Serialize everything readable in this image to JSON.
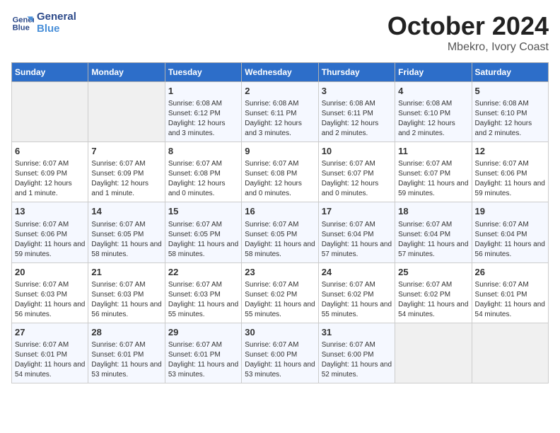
{
  "logo": {
    "line1": "General",
    "line2": "Blue"
  },
  "title": "October 2024",
  "subtitle": "Mbekro, Ivory Coast",
  "days_of_week": [
    "Sunday",
    "Monday",
    "Tuesday",
    "Wednesday",
    "Thursday",
    "Friday",
    "Saturday"
  ],
  "weeks": [
    [
      {
        "day": "",
        "info": ""
      },
      {
        "day": "",
        "info": ""
      },
      {
        "day": "1",
        "info": "Sunrise: 6:08 AM\nSunset: 6:12 PM\nDaylight: 12 hours and 3 minutes."
      },
      {
        "day": "2",
        "info": "Sunrise: 6:08 AM\nSunset: 6:11 PM\nDaylight: 12 hours and 3 minutes."
      },
      {
        "day": "3",
        "info": "Sunrise: 6:08 AM\nSunset: 6:11 PM\nDaylight: 12 hours and 2 minutes."
      },
      {
        "day": "4",
        "info": "Sunrise: 6:08 AM\nSunset: 6:10 PM\nDaylight: 12 hours and 2 minutes."
      },
      {
        "day": "5",
        "info": "Sunrise: 6:08 AM\nSunset: 6:10 PM\nDaylight: 12 hours and 2 minutes."
      }
    ],
    [
      {
        "day": "6",
        "info": "Sunrise: 6:07 AM\nSunset: 6:09 PM\nDaylight: 12 hours and 1 minute."
      },
      {
        "day": "7",
        "info": "Sunrise: 6:07 AM\nSunset: 6:09 PM\nDaylight: 12 hours and 1 minute."
      },
      {
        "day": "8",
        "info": "Sunrise: 6:07 AM\nSunset: 6:08 PM\nDaylight: 12 hours and 0 minutes."
      },
      {
        "day": "9",
        "info": "Sunrise: 6:07 AM\nSunset: 6:08 PM\nDaylight: 12 hours and 0 minutes."
      },
      {
        "day": "10",
        "info": "Sunrise: 6:07 AM\nSunset: 6:07 PM\nDaylight: 12 hours and 0 minutes."
      },
      {
        "day": "11",
        "info": "Sunrise: 6:07 AM\nSunset: 6:07 PM\nDaylight: 11 hours and 59 minutes."
      },
      {
        "day": "12",
        "info": "Sunrise: 6:07 AM\nSunset: 6:06 PM\nDaylight: 11 hours and 59 minutes."
      }
    ],
    [
      {
        "day": "13",
        "info": "Sunrise: 6:07 AM\nSunset: 6:06 PM\nDaylight: 11 hours and 59 minutes."
      },
      {
        "day": "14",
        "info": "Sunrise: 6:07 AM\nSunset: 6:05 PM\nDaylight: 11 hours and 58 minutes."
      },
      {
        "day": "15",
        "info": "Sunrise: 6:07 AM\nSunset: 6:05 PM\nDaylight: 11 hours and 58 minutes."
      },
      {
        "day": "16",
        "info": "Sunrise: 6:07 AM\nSunset: 6:05 PM\nDaylight: 11 hours and 58 minutes."
      },
      {
        "day": "17",
        "info": "Sunrise: 6:07 AM\nSunset: 6:04 PM\nDaylight: 11 hours and 57 minutes."
      },
      {
        "day": "18",
        "info": "Sunrise: 6:07 AM\nSunset: 6:04 PM\nDaylight: 11 hours and 57 minutes."
      },
      {
        "day": "19",
        "info": "Sunrise: 6:07 AM\nSunset: 6:04 PM\nDaylight: 11 hours and 56 minutes."
      }
    ],
    [
      {
        "day": "20",
        "info": "Sunrise: 6:07 AM\nSunset: 6:03 PM\nDaylight: 11 hours and 56 minutes."
      },
      {
        "day": "21",
        "info": "Sunrise: 6:07 AM\nSunset: 6:03 PM\nDaylight: 11 hours and 56 minutes."
      },
      {
        "day": "22",
        "info": "Sunrise: 6:07 AM\nSunset: 6:03 PM\nDaylight: 11 hours and 55 minutes."
      },
      {
        "day": "23",
        "info": "Sunrise: 6:07 AM\nSunset: 6:02 PM\nDaylight: 11 hours and 55 minutes."
      },
      {
        "day": "24",
        "info": "Sunrise: 6:07 AM\nSunset: 6:02 PM\nDaylight: 11 hours and 55 minutes."
      },
      {
        "day": "25",
        "info": "Sunrise: 6:07 AM\nSunset: 6:02 PM\nDaylight: 11 hours and 54 minutes."
      },
      {
        "day": "26",
        "info": "Sunrise: 6:07 AM\nSunset: 6:01 PM\nDaylight: 11 hours and 54 minutes."
      }
    ],
    [
      {
        "day": "27",
        "info": "Sunrise: 6:07 AM\nSunset: 6:01 PM\nDaylight: 11 hours and 54 minutes."
      },
      {
        "day": "28",
        "info": "Sunrise: 6:07 AM\nSunset: 6:01 PM\nDaylight: 11 hours and 53 minutes."
      },
      {
        "day": "29",
        "info": "Sunrise: 6:07 AM\nSunset: 6:01 PM\nDaylight: 11 hours and 53 minutes."
      },
      {
        "day": "30",
        "info": "Sunrise: 6:07 AM\nSunset: 6:00 PM\nDaylight: 11 hours and 53 minutes."
      },
      {
        "day": "31",
        "info": "Sunrise: 6:07 AM\nSunset: 6:00 PM\nDaylight: 11 hours and 52 minutes."
      },
      {
        "day": "",
        "info": ""
      },
      {
        "day": "",
        "info": ""
      }
    ]
  ]
}
